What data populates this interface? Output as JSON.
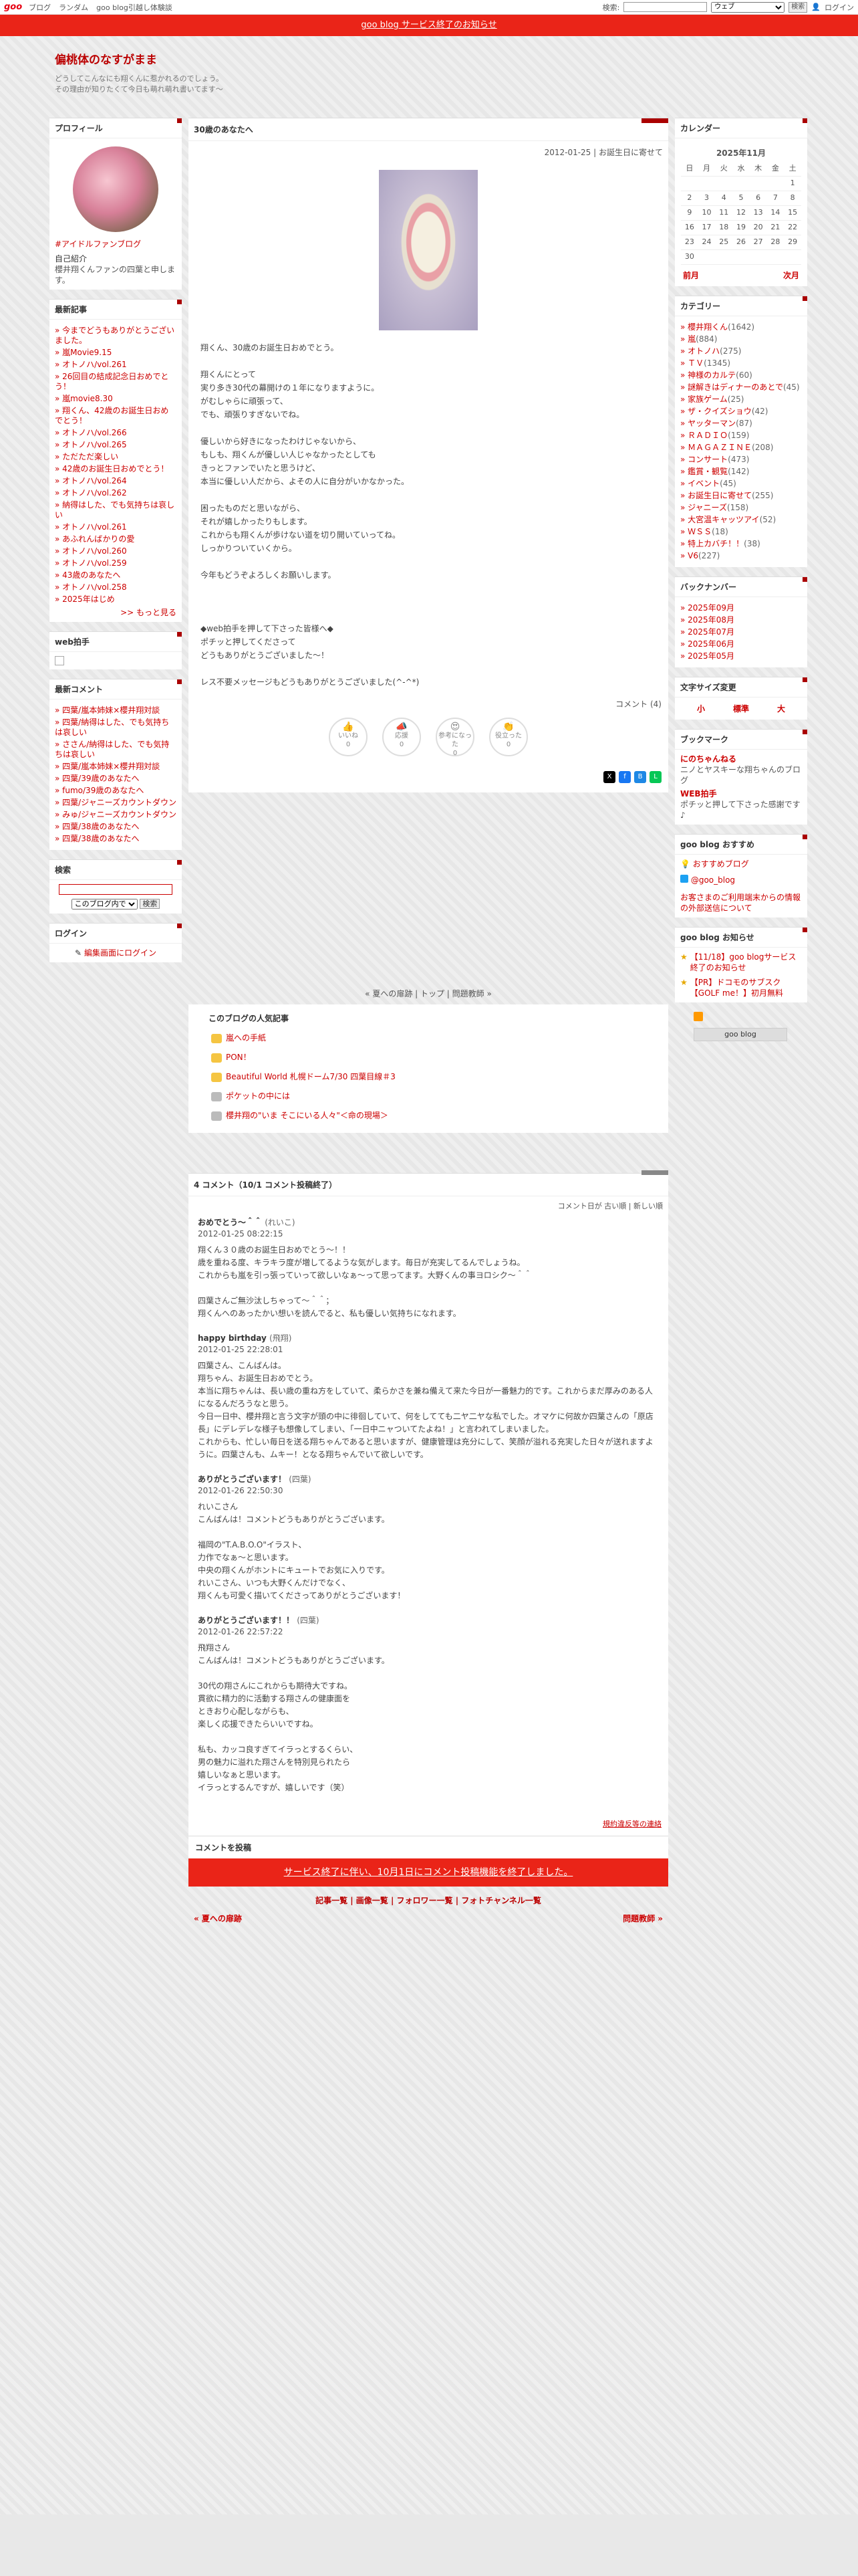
{
  "topbar": {
    "logo": "goo",
    "links": [
      "ブログ",
      "ランダム",
      "goo blog引越し体験談"
    ],
    "search_label": "検索:",
    "search_select": "ウェブ",
    "search_button": "検索",
    "login": "ログイン"
  },
  "notice": {
    "text": "goo blog サービス終了のお知らせ"
  },
  "header": {
    "title": "偏桃体のなすがまま",
    "desc1": "どうしてこんなにも翔くんに惹かれるのでしょう。",
    "desc2": "その理由が知りたくて今日も萌れ萌れ書いてます～"
  },
  "profile": {
    "title": "プロフィール",
    "fan": "#アイドルファンブログ",
    "intro_title": "自己紹介",
    "intro": "櫻井翔くんファンの四葉と申します。"
  },
  "recent": {
    "title": "最新記事",
    "items": [
      "今までどうもありがとうございました。",
      "嵐Movie9.15",
      "オトノハ/vol.261",
      "26回目の結成記念日おめでとう！",
      "嵐movie8.30",
      "翔くん、42歳のお誕生日おめでとう！",
      "オトノハ/vol.266",
      "オトノハ/vol.265",
      "ただただ楽しい",
      "42歳のお誕生日おめでとう！",
      "オトノハ/vol.264",
      "オトノハ/vol.262",
      "納得はした、でも気持ちは哀しい",
      "オトノハ/vol.261",
      "あふれんばかりの愛",
      "オトノハ/vol.260",
      "オトノハ/vol.259",
      "43歳のあなたへ",
      "オトノハ/vol.258",
      "2025年はじめ"
    ],
    "more": ">> もっと見る"
  },
  "webclap": {
    "title": "web拍手"
  },
  "recent_comments": {
    "title": "最新コメント",
    "items": [
      "四葉/嵐本姉妹×櫻井翔対談",
      "四葉/納得はした、でも気持ちは哀しい",
      "ささん/納得はした、でも気持ちは哀しい",
      "四葉/嵐本姉妹×櫻井翔対談",
      "四葉/39歳のあなたへ",
      "fumo/39歳のあなたへ",
      "四葉/ジャニーズカウントダウン",
      "みゅ/ジャニーズカウントダウン",
      "四葉/38歳のあなたへ",
      "四葉/38歳のあなたへ"
    ]
  },
  "search": {
    "title": "検索",
    "select": "このブログ内で",
    "button": "検索"
  },
  "login": {
    "title": "ログイン",
    "link": "編集画面にログイン"
  },
  "calendar": {
    "title": "カレンダー",
    "month": "2025年11月",
    "days": [
      "日",
      "月",
      "火",
      "水",
      "木",
      "金",
      "土"
    ],
    "weeks": [
      [
        "",
        "",
        "",
        "",
        "",
        "",
        "1"
      ],
      [
        "2",
        "3",
        "4",
        "5",
        "6",
        "7",
        "8"
      ],
      [
        "9",
        "10",
        "11",
        "12",
        "13",
        "14",
        "15"
      ],
      [
        "16",
        "17",
        "18",
        "19",
        "20",
        "21",
        "22"
      ],
      [
        "23",
        "24",
        "25",
        "26",
        "27",
        "28",
        "29"
      ],
      [
        "30",
        "",
        "",
        "",
        "",
        "",
        ""
      ]
    ],
    "prev": "前月",
    "next": "次月"
  },
  "categories": {
    "title": "カテゴリー",
    "items": [
      [
        "櫻井翔くん",
        "(1642)"
      ],
      [
        "嵐",
        "(884)"
      ],
      [
        "オトノハ",
        "(275)"
      ],
      [
        "ＴＶ",
        "(1345)"
      ],
      [
        "神様のカルテ",
        "(60)"
      ],
      [
        "謎解きはディナーのあとで",
        "(45)"
      ],
      [
        "家族ゲーム",
        "(25)"
      ],
      [
        "ザ・クイズショウ",
        "(42)"
      ],
      [
        "ヤッターマン",
        "(87)"
      ],
      [
        "ＲＡＤＩＯ",
        "(159)"
      ],
      [
        "ＭＡＧＡＺＩＮＥ",
        "(208)"
      ],
      [
        "コンサート",
        "(473)"
      ],
      [
        "鑑賞・観覧",
        "(142)"
      ],
      [
        "イベント",
        "(45)"
      ],
      [
        "お誕生日に寄せて",
        "(255)"
      ],
      [
        "ジャニーズ",
        "(158)"
      ],
      [
        "大宮温キャッツアイ",
        "(52)"
      ],
      [
        "ＷＳＳ",
        "(18)"
      ],
      [
        "特上カバチ！！",
        "(38)"
      ],
      [
        "V6",
        "(227)"
      ]
    ]
  },
  "backnumber": {
    "title": "バックナンバー",
    "items": [
      "2025年09月",
      "2025年08月",
      "2025年07月",
      "2025年06月",
      "2025年05月"
    ]
  },
  "fontsize": {
    "title": "文字サイズ変更",
    "small": "小",
    "medium": "標準",
    "large": "大"
  },
  "bookmark": {
    "title": "ブックマーク",
    "b1_title": "にのちゃんねる",
    "b1_desc": "ニノとヤスキーな翔ちゃんのブログ",
    "b2_title": "WEB拍手",
    "b2_desc": "ポチッと押して下さった感謝です♪"
  },
  "recommend": {
    "title": "goo blog おすすめ",
    "i1": "おすすめブログ",
    "i2": "@goo_blog",
    "i3": "お客さまのご利用端末からの情報の外部送信について"
  },
  "news": {
    "title": "goo blog お知らせ",
    "i1": "【11/18】goo blogサービス終了のお知らせ",
    "i2": "【PR】ドコモのサブスク【GOLF me！】初月無料"
  },
  "bottomlogo": "goo blog",
  "article": {
    "title": "30歳のあなたへ",
    "meta": "2012-01-25 | お誕生日に寄せて",
    "body": "翔くん、30歳のお誕生日おめでとう。\n\n翔くんにとって\n実り多き30代の幕開けの１年になりますように。\nがむしゃらに頑張って、\nでも、頑張りすぎないでね。\n\n優しいから好きになったわけじゃないから、\nもしも、翔くんが優しい人じゃなかったとしても\nきっとファンでいたと思うけど、\n本当に優しい人だから、よその人に自分がいかなかった。\n\n困ったものだと思いながら、\nそれが嬉しかったりもします。\nこれからも翔くんが歩けない道を切り開いていってね。\nしっかりついていくから。\n\n今年もどうぞよろしくお願いします。\n\n\n\n◆web拍手を押して下さった皆様へ◆\nポチッと押してくださって\nどうもありがとうございました～！\n\nレス不要メッセージもどうもありがとうございました(^-^*)",
    "comment_link": "コメント (4)",
    "reactions": [
      [
        "いいね",
        "0"
      ],
      [
        "応援",
        "0"
      ],
      [
        "参考になった",
        "0"
      ],
      [
        "役立った",
        "0"
      ]
    ],
    "postnav": "« 夏への扉跡 | トップ | 問題教師 »"
  },
  "popular": {
    "title": "このブログの人気記事",
    "items": [
      "嵐への手紙",
      "PON！",
      "Beautiful World 札幌ドーム7/30 四葉目線＃3",
      "ポケットの中には",
      "櫻井翔の\"いま そこにいる人々\"＜命の現場＞"
    ]
  },
  "comments": {
    "title": "4 コメント（10/1 コメント投稿終了）",
    "sort": "コメント日が 古い順 | 新しい順",
    "items": [
      {
        "name": "おめでとう～＾＾",
        "from": "(れいこ)",
        "date": "2012-01-25 08:22:15",
        "text": "翔くん３０歳のお誕生日おめでとう～！！\n歳を重ねる度、キラキラ度が増してるような気がします。毎日が充実してるんでしょうね。\nこれからも嵐を引っ張っていって欲しいなぁ～って思ってます。大野くんの事ヨロシク～＾＾\n\n四葉さんご無沙汰しちゃって～＾＾；\n翔くんへのあったかい想いを読んでると、私も優しい気持ちになれます。"
      },
      {
        "name": "happy birthday",
        "from": "(飛翔)",
        "date": "2012-01-25 22:28:01",
        "text": "四葉さん、こんばんは。\n翔ちゃん、お誕生日おめでとう。\n本当に翔ちゃんは、長い歳の重ね方をしていて、柔らかさを兼ね備えて来た今日が一番魅力的です。これからまだ厚みのある人になるんだろうなと思う。\n今日一日中、櫻井翔と言う文字が頭の中に徘徊していて、何をしてても二ヤ二ヤな私でした。オマケに何故か四葉さんの「原店長」にデレデレな様子も想像してしまい、「一日中ニャついてたよね！」と言われてしまいました。\nこれからも、忙しい毎日を送る翔ちゃんであると思いますが、健康管理は充分にして、笑顔が溢れる充実した日々が送れますように。四葉さんも、ムキー！となる翔ちゃんでいて欲しいです。"
      },
      {
        "name": "ありがとうございます！",
        "from": "(四葉)",
        "date": "2012-01-26 22:50:30",
        "text": "れいこさん\nこんばんは！コメントどうもありがとうございます。\n\n福岡の\"T.A.B.O.O\"イラスト、\n力作でなぁ～と思います。\n中央の翔くんがホントにキュートでお気に入りです。\nれいこさん、いつも大野くんだけでなく、\n翔くんも可愛く描いてくださってありがとうございます！"
      },
      {
        "name": "ありがとうございます！！",
        "from": "(四葉)",
        "date": "2012-01-26 22:57:22",
        "text": "飛翔さん\nこんばんは！コメントどうもありがとうございます。\n\n30代の翔さんにこれからも期待大ですね。\n貫欲に精力的に活動する翔さんの健康面を\nときおり心配しながらも、\n楽しく応援できたらいいですね。\n\n私も、カッコ良すぎてイラっとするくらい、\n男の魅力に溢れた翔さんを特別見られたら\n嬉しいなぁと思います。\nイラっとするんですが、嬉しいです（笑）"
      }
    ],
    "guide": "規約違反等の連絡"
  },
  "postform": {
    "title": "コメントを投稿",
    "banner": "サービス終了に伴い、10月1日にコメント投稿機能を終了しました。",
    "nav": "記事一覧 | 画像一覧 | フォロワー一覧 | フォトチャンネル一覧",
    "prev": "« 夏への扉跡",
    "next": "問題教師 »"
  }
}
